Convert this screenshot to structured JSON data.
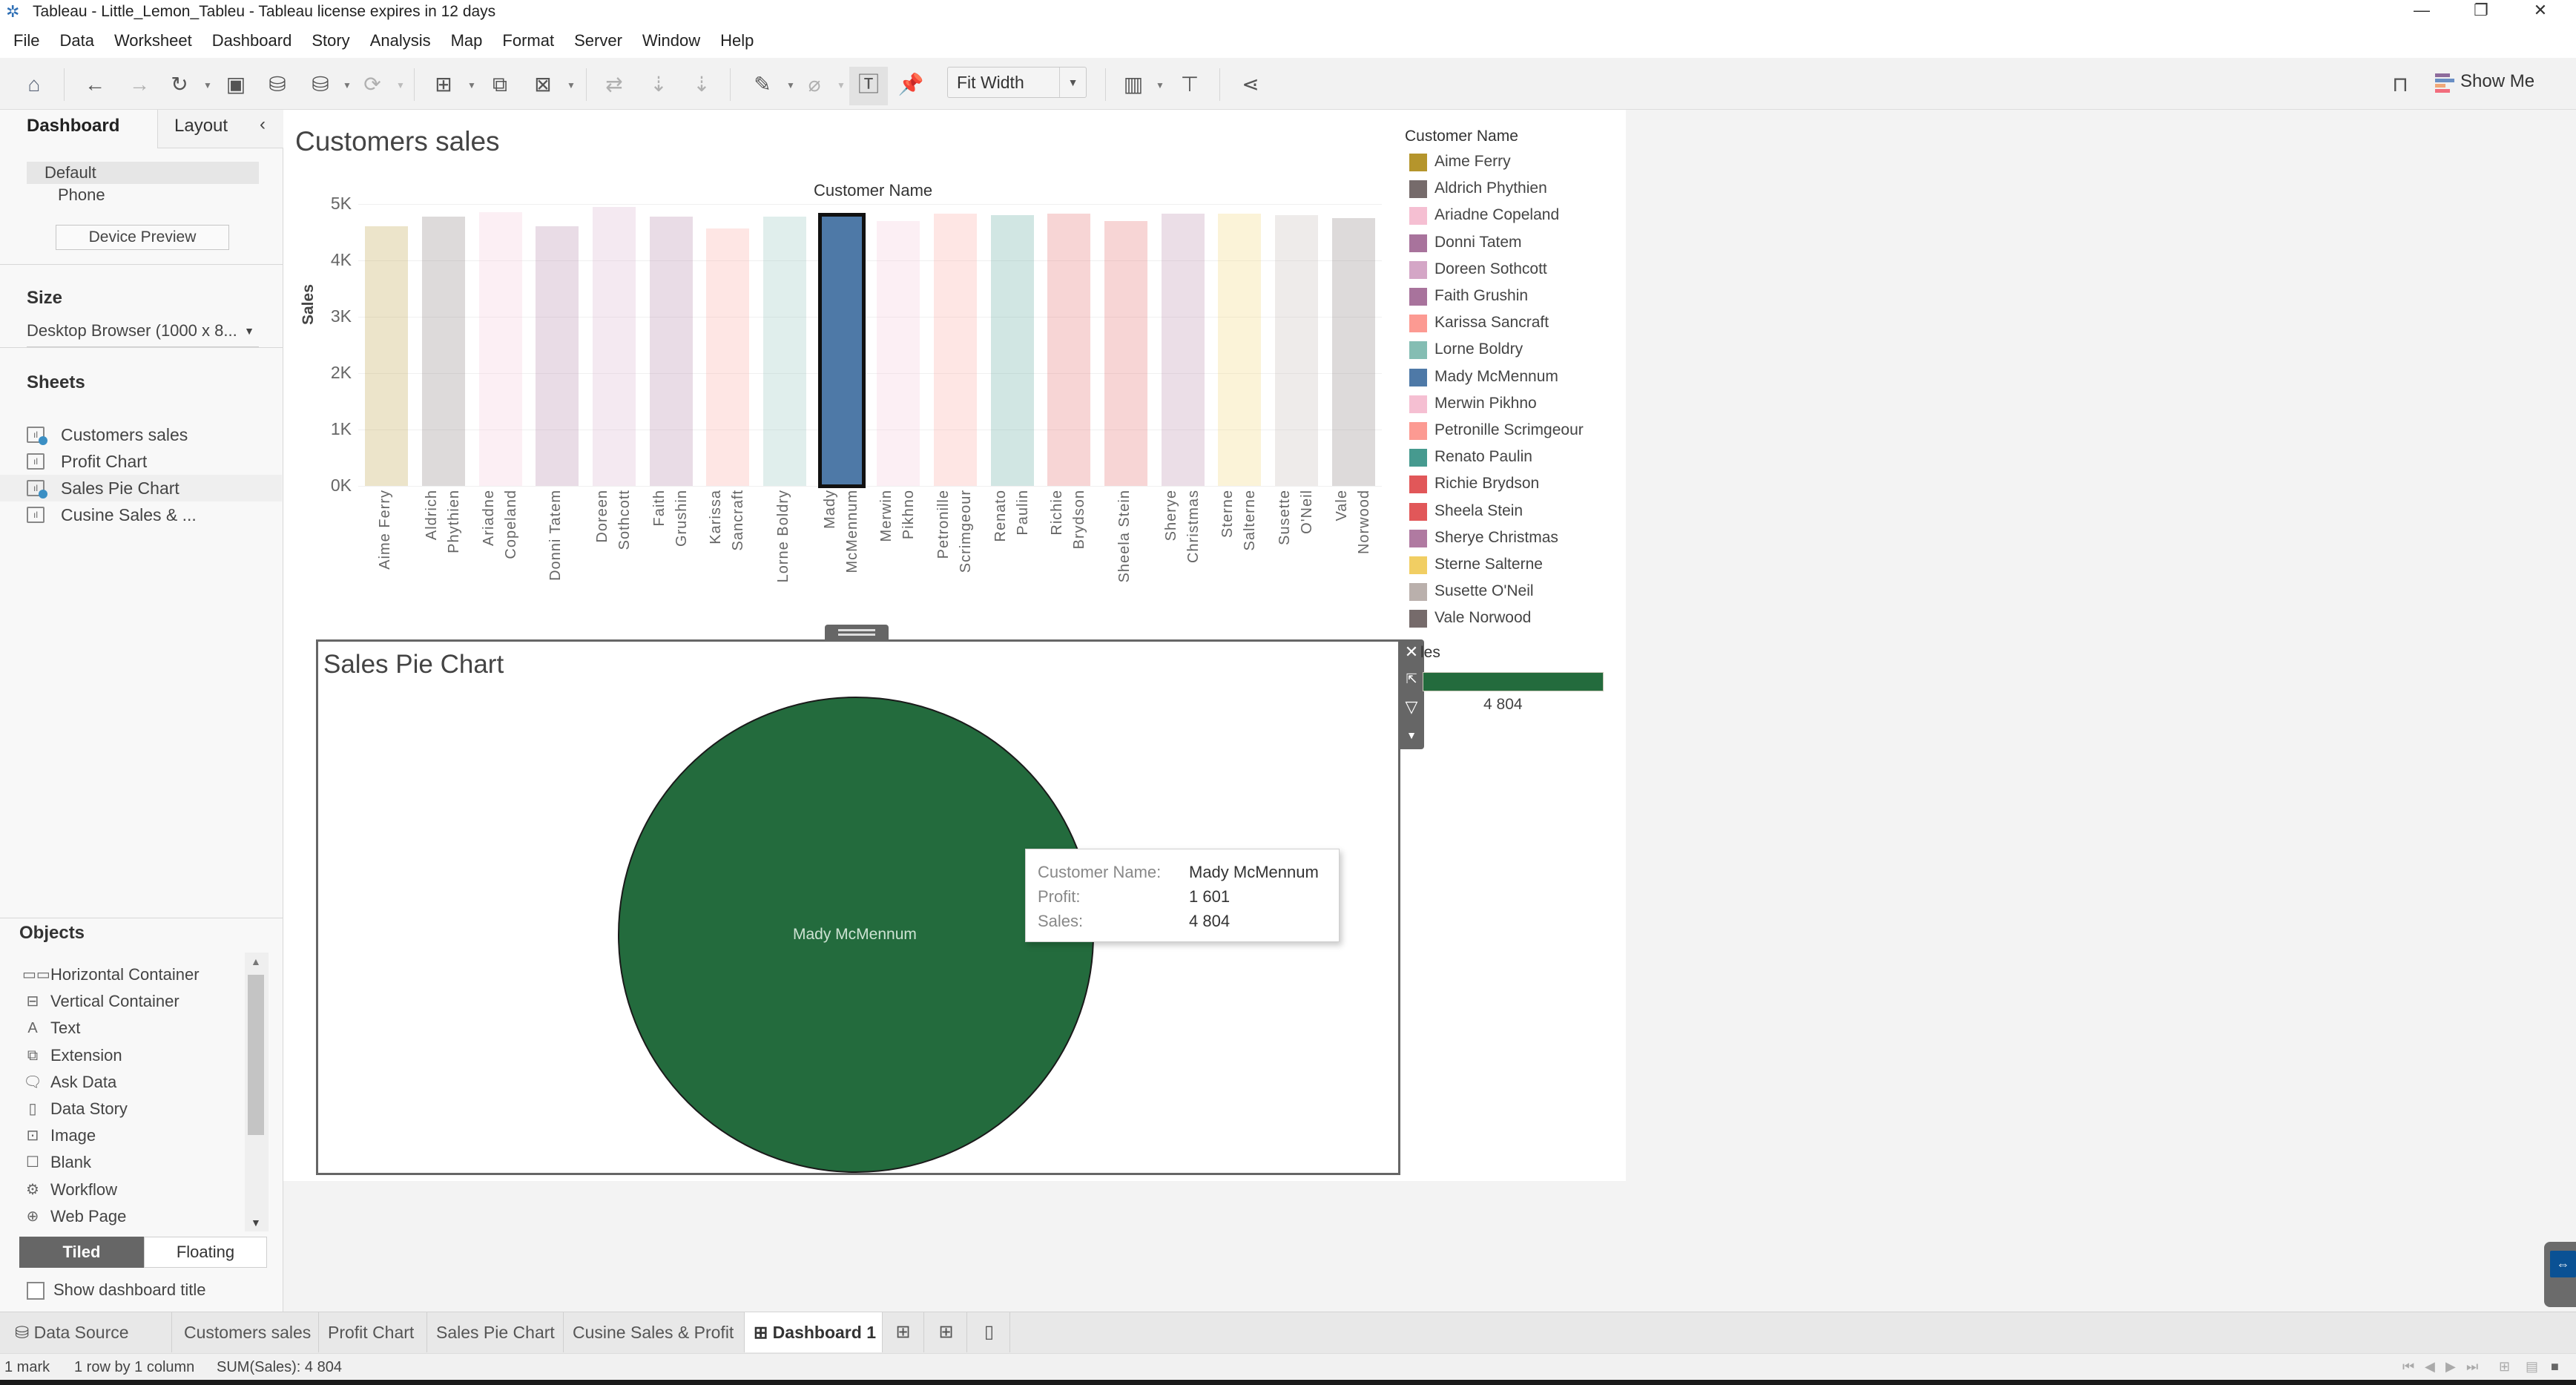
{
  "window": {
    "title": "Tableau - Little_Lemon_Tableu - Tableau license expires in 12 days",
    "controls": [
      "minimize",
      "restore",
      "close"
    ]
  },
  "menu": [
    "File",
    "Data",
    "Worksheet",
    "Dashboard",
    "Story",
    "Analysis",
    "Map",
    "Format",
    "Server",
    "Window",
    "Help"
  ],
  "toolbar": {
    "fit_select": "Fit Width",
    "show_me": "Show Me",
    "icons": [
      "home-icon",
      "undo-icon",
      "redo-icon",
      "replay-icon",
      "save-icon",
      "new-datasource-icon",
      "pause-updates-icon",
      "refresh-icon",
      "new-worksheet-icon",
      "duplicate-icon",
      "clear-sheet-icon",
      "swap-icon",
      "sort-ascending-icon",
      "sort-descending-icon",
      "highlight-icon",
      "group-icon",
      "show-labels-icon",
      "pin-axis-icon",
      "show-cards-icon",
      "presentation-icon",
      "share-icon",
      "tooltip-sign-icon"
    ]
  },
  "left_panel": {
    "tabs": {
      "dashboard": "Dashboard",
      "layout": "Layout"
    },
    "device_options": [
      "Default",
      "Phone"
    ],
    "device_preview": "Device Preview",
    "size_title": "Size",
    "size_value": "Desktop Browser (1000 x 8...",
    "sheets_title": "Sheets",
    "sheets": [
      {
        "label": "Customers sales",
        "in_use": true
      },
      {
        "label": "Profit Chart",
        "in_use": false
      },
      {
        "label": "Sales Pie Chart",
        "in_use": true
      },
      {
        "label": "Cusine Sales & ...",
        "in_use": false
      }
    ],
    "objects_title": "Objects",
    "objects": [
      {
        "label": "Horizontal Container",
        "icon": "horizontal-container-icon",
        "glyph": "▭▭"
      },
      {
        "label": "Vertical Container",
        "icon": "vertical-container-icon",
        "glyph": "⊟"
      },
      {
        "label": "Text",
        "icon": "text-icon",
        "glyph": "A"
      },
      {
        "label": "Extension",
        "icon": "extension-icon",
        "glyph": "⧉"
      },
      {
        "label": "Ask Data",
        "icon": "ask-data-icon",
        "glyph": "🗨"
      },
      {
        "label": "Data Story",
        "icon": "data-story-icon",
        "glyph": "▯"
      },
      {
        "label": "Image",
        "icon": "image-icon",
        "glyph": "⊡"
      },
      {
        "label": "Blank",
        "icon": "blank-icon",
        "glyph": "☐"
      },
      {
        "label": "Workflow",
        "icon": "workflow-icon",
        "glyph": "⚙"
      },
      {
        "label": "Web Page",
        "icon": "web-page-icon",
        "glyph": "⊕"
      }
    ],
    "tiled": "Tiled",
    "floating": "Floating",
    "show_dashboard_title": "Show dashboard title"
  },
  "chart_data": [
    {
      "type": "bar",
      "title": "Customers sales",
      "xlabel": "Customer Name",
      "ylabel": "Sales",
      "ylim": [
        0,
        5000
      ],
      "yticks": [
        "0K",
        "1K",
        "2K",
        "3K",
        "4K",
        "5K"
      ],
      "grid": true,
      "selected": "Mady McMennum",
      "categories": [
        "Aime Ferry",
        "Aldrich Phythien",
        "Ariadne Copeland",
        "Donni Tatem",
        "Doreen Sothcott",
        "Faith Grushin",
        "Karissa Sancraft",
        "Lorne Boldry",
        "Mady McMennum",
        "Merwin Pikhno",
        "Petronille Scrimgeour",
        "Renato Paulin",
        "Richie Brydson",
        "Sheela Stein",
        "Sherye Christmas",
        "Sterne Salterne",
        "Susette O'Neil",
        "Vale Norwood"
      ],
      "label_lines": [
        [
          "Aime Ferry"
        ],
        [
          "Aldrich",
          "Phythien"
        ],
        [
          "Ariadne",
          "Copeland"
        ],
        [
          "Donni Tatem"
        ],
        [
          "Doreen",
          "Sothcott"
        ],
        [
          "Faith",
          "Grushin"
        ],
        [
          "Karissa",
          "Sancraft"
        ],
        [
          "Lorne Boldry"
        ],
        [
          "Mady",
          "McMennum"
        ],
        [
          "Merwin",
          "Pikhno"
        ],
        [
          "Petronille",
          "Scrimgeour"
        ],
        [
          "Renato",
          "Paulin"
        ],
        [
          "Richie",
          "Brydson"
        ],
        [
          "Sheela Stein"
        ],
        [
          "Sherye",
          "Christmas"
        ],
        [
          "Sterne",
          "Salterne"
        ],
        [
          "Susette",
          "O'Neil"
        ],
        [
          "Vale",
          "Norwood"
        ]
      ],
      "values": [
        4600,
        4780,
        4860,
        4600,
        4950,
        4780,
        4570,
        4780,
        4804,
        4700,
        4830,
        4800,
        4830,
        4700,
        4830,
        4830,
        4800,
        4750
      ],
      "colors": [
        "#b5952c",
        "#766b6b",
        "#f5bfd2",
        "#a8739c",
        "#d4a6c6",
        "#a8739c",
        "#fc9a92",
        "#84bdb3",
        "#4e79a7",
        "#f5bfd2",
        "#fc9a92",
        "#469a8f",
        "#e15759",
        "#e15759",
        "#b07aa1",
        "#f1ce63",
        "#bab0ac",
        "#766b6b"
      ],
      "legend": {
        "title": "Customer Name",
        "position": "right"
      }
    },
    {
      "type": "pie",
      "title": "Sales Pie Chart",
      "categories": [
        "Mady McMennum"
      ],
      "values": [
        4804
      ],
      "colors": [
        "#236b3d"
      ],
      "legend": {
        "title": "Sales",
        "value_label": "4 804",
        "position": "right"
      }
    }
  ],
  "tooltip": {
    "rows": [
      {
        "key": "Customer Name:",
        "value": "Mady McMennum"
      },
      {
        "key": "Profit:",
        "value": "1 601"
      },
      {
        "key": "Sales:",
        "value": "4 804"
      }
    ]
  },
  "sales_legend": {
    "title": "les",
    "value": "4 804"
  },
  "bottom_tabs": [
    {
      "label": "Data Source",
      "icon": "datasource-icon",
      "active": false
    },
    {
      "label": "Customers sales",
      "active": false
    },
    {
      "label": "Profit Chart",
      "active": false
    },
    {
      "label": "Sales Pie Chart",
      "active": false
    },
    {
      "label": "Cusine Sales & Profit",
      "active": false
    },
    {
      "label": "Dashboard 1",
      "icon": "dashboard-icon",
      "active": true
    }
  ],
  "status": {
    "marks": "1 mark",
    "dims": "1 row by 1 column",
    "sum": "SUM(Sales): 4 804"
  }
}
